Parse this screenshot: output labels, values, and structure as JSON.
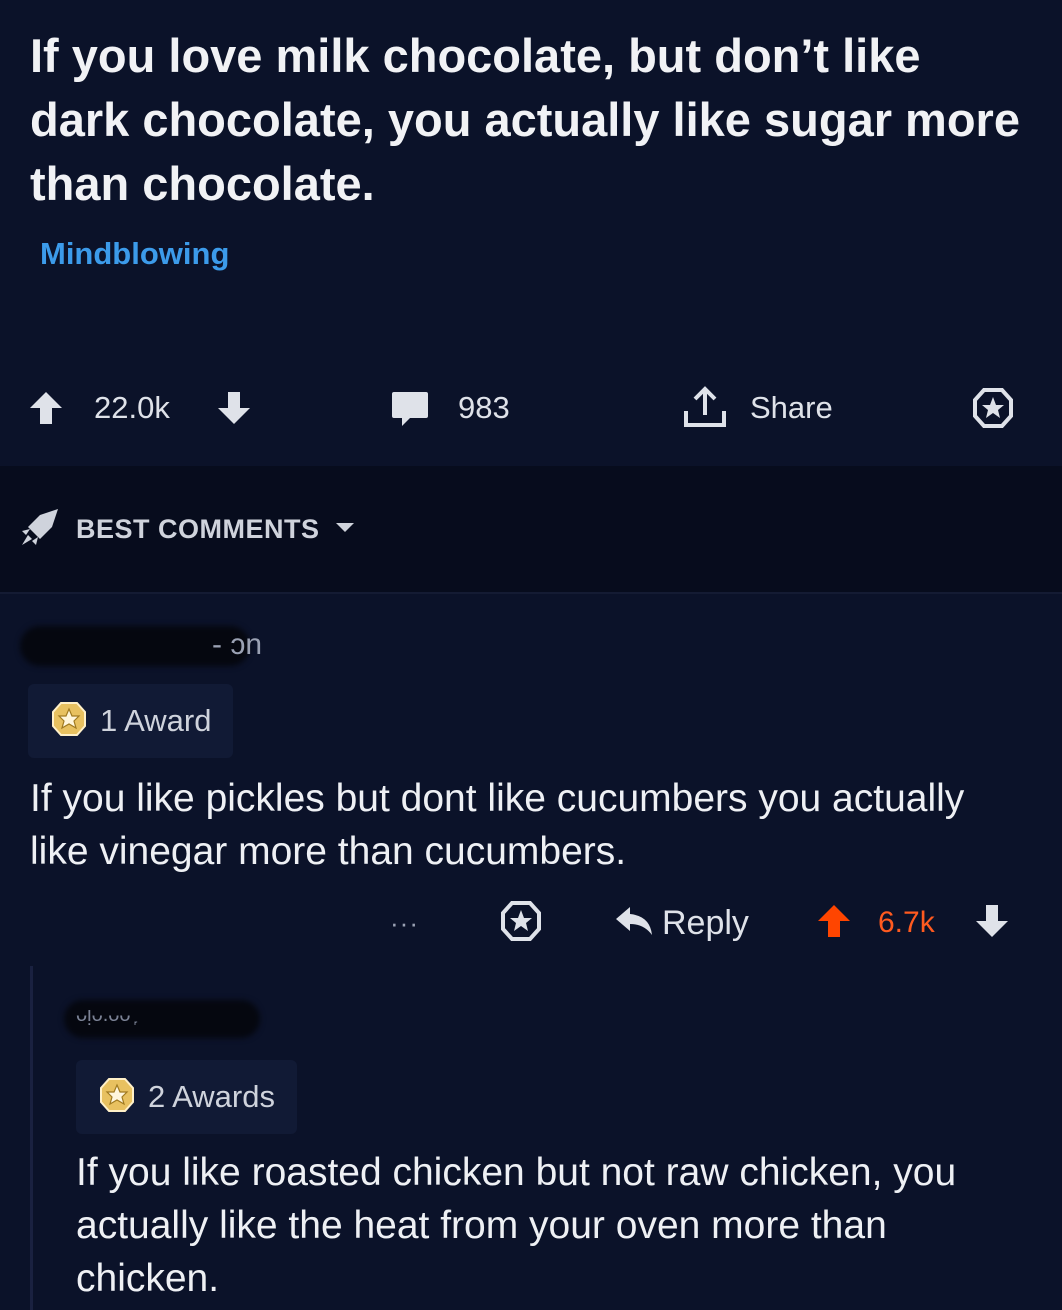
{
  "post": {
    "title": "If you love milk chocolate, but don’t like dark chocolate, you actually like sugar more than chocolate.",
    "flair": "Mindblowing",
    "score": "22.0k",
    "comments_count": "983",
    "share_label": "Share"
  },
  "sort": {
    "label": "BEST COMMENTS"
  },
  "comments": [
    {
      "username_fragment": "- ɔn",
      "award_label": "1 Award",
      "body": "If you like pickles but dont like cucumbers you actually like vinegar more than cucumbers.",
      "more_label": "···",
      "reply_label": "Reply",
      "score": "6.7k"
    },
    {
      "username_fragment": "ᴗᴉᴗ.ᴗᴗ ᷊᷊᷊",
      "award_label": "2 Awards",
      "body": "If you like roasted chicken but not raw chicken, you actually like the heat from your oven more than chicken."
    }
  ],
  "colors": {
    "background": "#0b1229",
    "band": "#070c1d",
    "flair": "#3c9bea",
    "upvote_active": "#ff4500",
    "award_gold": "#e8c160"
  },
  "icons": [
    "upvote-icon",
    "downvote-icon",
    "comment-icon",
    "share-icon",
    "award-icon",
    "sort-rocket-icon",
    "chevron-down-icon",
    "reply-icon",
    "more-icon"
  ]
}
